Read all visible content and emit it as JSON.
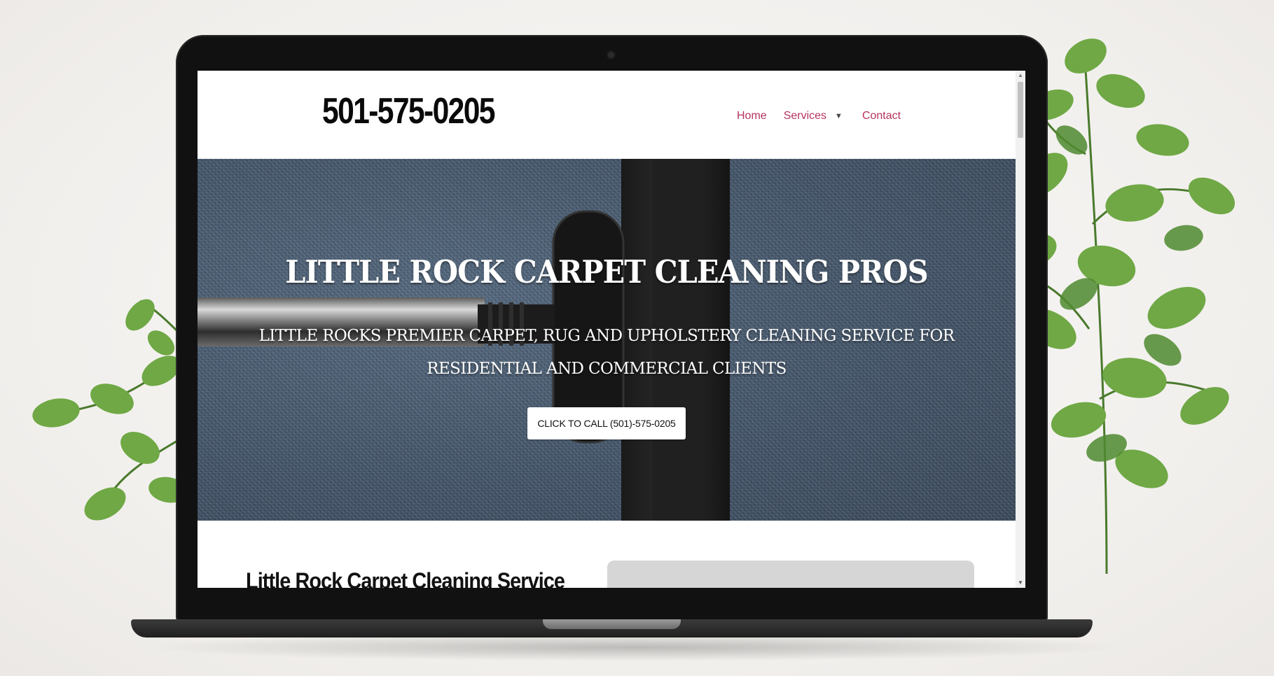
{
  "site": {
    "phone_display": "501-575-0205",
    "nav": {
      "home": "Home",
      "services": "Services",
      "services_caret": "▼",
      "contact": "Contact"
    }
  },
  "hero": {
    "title": "LITTLE ROCK CARPET CLEANING PROS",
    "subtitle": "LITTLE ROCKS PREMIER CARPET, RUG AND UPHOLSTERY CLEANING SERVICE FOR RESIDENTIAL AND COMMERCIAL CLIENTS",
    "cta_label": "CLICK TO CALL (501)-575-0205"
  },
  "content": {
    "section_title": "Little Rock Carpet Cleaning Service"
  },
  "scrollbar": {
    "up_arrow": "▲",
    "down_arrow": "▼"
  },
  "colors": {
    "nav_link": "#b4345c",
    "hero_carpet": "#4a5c70",
    "laptop_frame": "#111111",
    "page_background": "#f3f1ef"
  },
  "icons": {
    "plants": "leaf-plant-decoration",
    "vacuum": "vacuum-nozzle-image"
  }
}
